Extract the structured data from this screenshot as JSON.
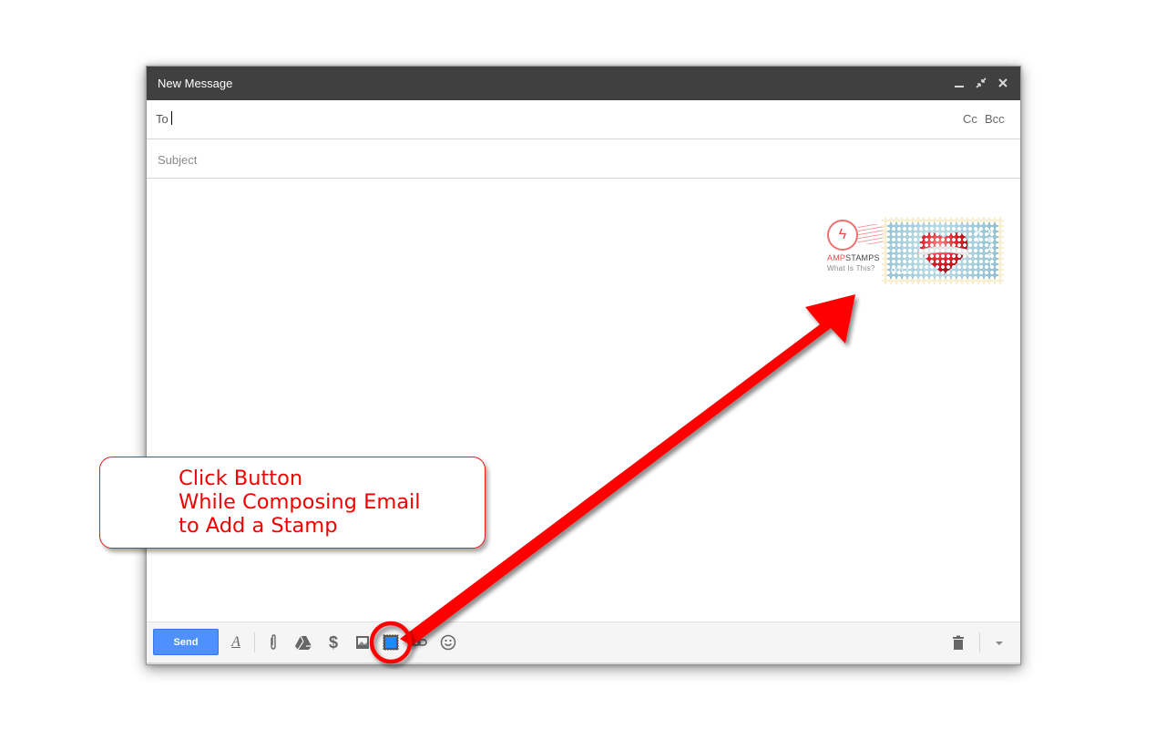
{
  "window": {
    "title": "New Message",
    "controls": [
      {
        "name": "minimize-icon",
        "glyph": "_"
      },
      {
        "name": "pop-out-icon",
        "glyph": "⤡"
      },
      {
        "name": "close-icon",
        "glyph": "✕"
      }
    ]
  },
  "fields": {
    "to_label": "To",
    "to_value": "",
    "cc_label": "Cc",
    "bcc_label": "Bcc",
    "subject_placeholder": "Subject",
    "subject_value": ""
  },
  "stamp": {
    "brand_prefix": "AMP",
    "brand_suffix": "STAMPS",
    "brand_link": "What Is This?",
    "number": "0012",
    "text_line1": "MY",
    "text_line2": "HEART",
    "colors": {
      "background": "#9fcad8",
      "heart": "#e0202a",
      "border": "#f7efd2"
    }
  },
  "toolbar": {
    "send_label": "Send",
    "items": [
      {
        "name": "formatting-icon",
        "glyph": "A"
      },
      {
        "name": "attach-icon",
        "glyph": "📎"
      },
      {
        "name": "drive-icon",
        "glyph": "▲"
      },
      {
        "name": "money-icon",
        "glyph": "$"
      },
      {
        "name": "photo-icon",
        "glyph": "▨"
      },
      {
        "name": "stamp-icon",
        "glyph": "▣"
      },
      {
        "name": "link-icon",
        "glyph": "⊂⊃"
      },
      {
        "name": "emoji-icon",
        "glyph": "☺"
      }
    ],
    "discard_icon": "🗑",
    "more_icon": "▾"
  },
  "callout": {
    "lines": [
      "Click Button",
      "While Composing Email",
      "to Add a Stamp"
    ],
    "color": "#f00000"
  },
  "colors": {
    "titlebar": "#404040",
    "send": "#4d90fe",
    "annotation": "#ff0000"
  }
}
